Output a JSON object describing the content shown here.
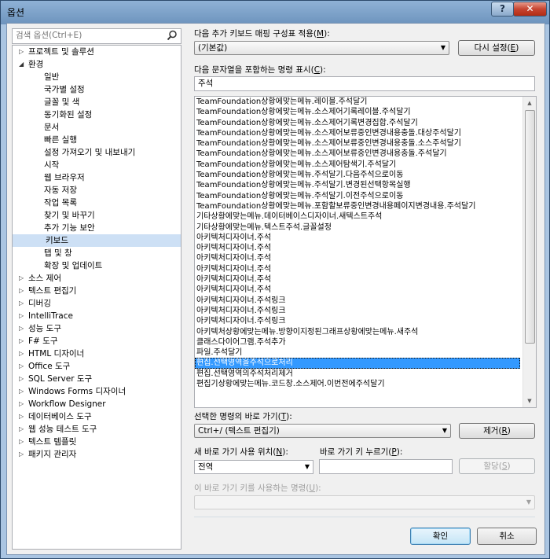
{
  "window": {
    "title": "옵션",
    "help_label": "?",
    "close_label": "✕"
  },
  "search": {
    "placeholder": "검색 옵션(Ctrl+E)",
    "icon": "search-icon"
  },
  "tree": [
    {
      "label": "프로젝트 및 솔루션",
      "level": 0,
      "arrow": "▷"
    },
    {
      "label": "환경",
      "level": 0,
      "arrow": "◢"
    },
    {
      "label": "일반",
      "level": 1
    },
    {
      "label": "국가별 설정",
      "level": 1
    },
    {
      "label": "글꼴 및 색",
      "level": 1
    },
    {
      "label": "동기화된 설정",
      "level": 1
    },
    {
      "label": "문서",
      "level": 1
    },
    {
      "label": "빠른 실행",
      "level": 1
    },
    {
      "label": "설정 가져오기 및 내보내기",
      "level": 1
    },
    {
      "label": "시작",
      "level": 1
    },
    {
      "label": "웹 브라우저",
      "level": 1
    },
    {
      "label": "자동 저장",
      "level": 1
    },
    {
      "label": "작업 목록",
      "level": 1
    },
    {
      "label": "찾기 및 바꾸기",
      "level": 1
    },
    {
      "label": "추가 기능 보안",
      "level": 1
    },
    {
      "label": "키보드",
      "level": 1,
      "selected": true
    },
    {
      "label": "탭 및 창",
      "level": 1
    },
    {
      "label": "확장 및 업데이트",
      "level": 1
    },
    {
      "label": "소스 제어",
      "level": 0,
      "arrow": "▷"
    },
    {
      "label": "텍스트 편집기",
      "level": 0,
      "arrow": "▷"
    },
    {
      "label": "디버깅",
      "level": 0,
      "arrow": "▷"
    },
    {
      "label": "IntelliTrace",
      "level": 0,
      "arrow": "▷"
    },
    {
      "label": "성능 도구",
      "level": 0,
      "arrow": "▷"
    },
    {
      "label": "F# 도구",
      "level": 0,
      "arrow": "▷"
    },
    {
      "label": "HTML 디자이너",
      "level": 0,
      "arrow": "▷"
    },
    {
      "label": "Office 도구",
      "level": 0,
      "arrow": "▷"
    },
    {
      "label": "SQL Server 도구",
      "level": 0,
      "arrow": "▷"
    },
    {
      "label": "Windows Forms 디자이너",
      "level": 0,
      "arrow": "▷"
    },
    {
      "label": "Workflow Designer",
      "level": 0,
      "arrow": "▷"
    },
    {
      "label": "데이터베이스 도구",
      "level": 0,
      "arrow": "▷"
    },
    {
      "label": "웹 성능 테스트 도구",
      "level": 0,
      "arrow": "▷"
    },
    {
      "label": "텍스트 템플릿",
      "level": 0,
      "arrow": "▷"
    },
    {
      "label": "패키지 관리자",
      "level": 0,
      "arrow": "▷"
    }
  ],
  "mapping": {
    "label_prefix": "다음 추가 키보드 매핑 구성표 적용(",
    "label_key": "M",
    "label_suffix": "):",
    "value": "(기본값)",
    "reset_prefix": "다시 설정(",
    "reset_key": "E",
    "reset_suffix": ")"
  },
  "filter": {
    "label_prefix": "다음 문자열을 포함하는 명령 표시(",
    "label_key": "C",
    "label_suffix": "):",
    "value": "주석"
  },
  "commands": [
    "TeamFoundation상황에맞는메뉴.레이블.주석달기",
    "TeamFoundation상황에맞는메뉴.소스제어기록레이블.주석달기",
    "TeamFoundation상황에맞는메뉴.소스제어기록변경집합.주석달기",
    "TeamFoundation상황에맞는메뉴.소스제어보류중인변경내용충돌.대상주석달기",
    "TeamFoundation상황에맞는메뉴.소스제어보류중인변경내용충돌.소스주석달기",
    "TeamFoundation상황에맞는메뉴.소스제어보류중인변경내용충돌.주석달기",
    "TeamFoundation상황에맞는메뉴.소스제어탐색기.주석달기",
    "TeamFoundation상황에맞는메뉴.주석달기.다음주석으로이동",
    "TeamFoundation상황에맞는메뉴.주석달기.변경된선택항목실행",
    "TeamFoundation상황에맞는메뉴.주석달기.이전주석으로이동",
    "TeamFoundation상황에맞는메뉴.포함할보류중인변경내용페이지변경내용.주석달기",
    "기타상황에맞는메뉴.데이터베이스디자이너.새텍스트주석",
    "기타상황에맞는메뉴.텍스트주석.글꼴설정",
    "아키텍처디자이너.주석",
    "아키텍처디자이너.주석",
    "아키텍처디자이너.주석",
    "아키텍처디자이너.주석",
    "아키텍처디자이너.주석",
    "아키텍처디자이너.주석",
    "아키텍처디자이너.주석링크",
    "아키텍처디자이너.주석링크",
    "아키텍처디자이너.주석링크",
    "아키텍처상황에맞는메뉴.방향이지정된그래프상황에맞는메뉴.새주석",
    "클래스다이어그램.주석추가",
    "파일.주석달기",
    "편집.선택영역을주석으로처리",
    "편집.선택영역의주석처리제거",
    "편집기상황에맞는메뉴.코드창.소스제어.이번전에주석달기"
  ],
  "selected_command_index": 25,
  "shortcuts": {
    "label_prefix": "선택한 명령의 바로 가기(",
    "label_key": "T",
    "label_suffix": "):",
    "value": "Ctrl+/ (텍스트 편집기)",
    "remove_prefix": "제거(",
    "remove_key": "R",
    "remove_suffix": ")"
  },
  "new_shortcut": {
    "scope_label_prefix": "새 바로 가기 사용 위치(",
    "scope_label_key": "N",
    "scope_label_suffix": "):",
    "scope_value": "전역",
    "keys_label_prefix": "바로 가기 키 누르기(",
    "keys_label_key": "P",
    "keys_label_suffix": "):",
    "keys_value": "",
    "assign_prefix": "할당(",
    "assign_key": "S",
    "assign_suffix": ")"
  },
  "used_by": {
    "label_prefix": "이 바로 가기 키를 사용하는 명령(",
    "label_key": "U",
    "label_suffix": "):",
    "value": ""
  },
  "footer": {
    "ok_label": "확인",
    "cancel_label": "취소"
  }
}
